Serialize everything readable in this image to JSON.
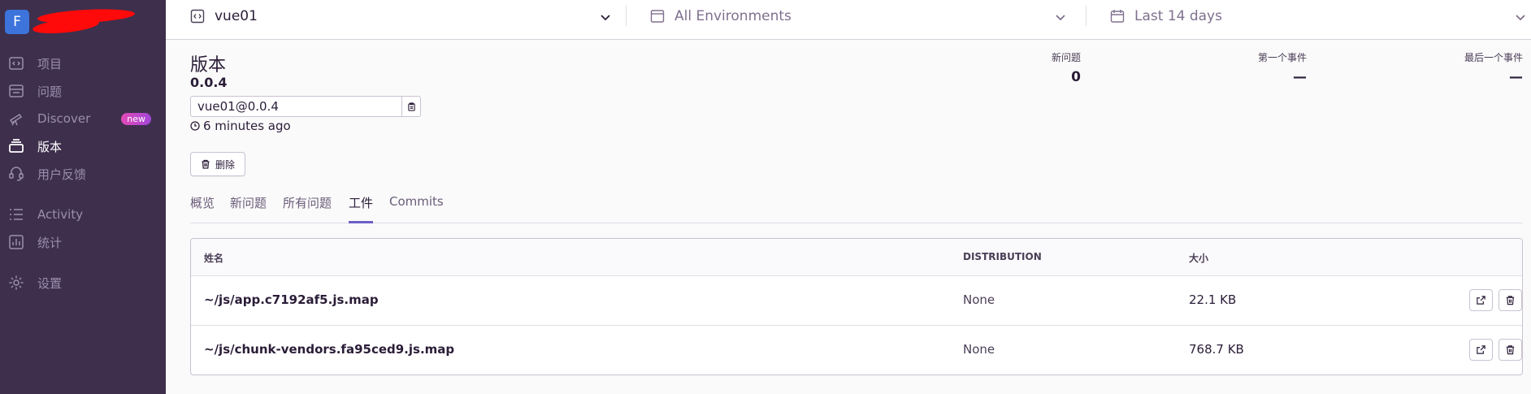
{
  "sidebar": {
    "org_initial": "F",
    "items": [
      {
        "label": "项目",
        "icon": "projects-icon"
      },
      {
        "label": "问题",
        "icon": "issues-icon"
      },
      {
        "label": "Discover",
        "icon": "telescope-icon",
        "badge": "new"
      },
      {
        "label": "版本",
        "icon": "releases-icon",
        "active": true
      },
      {
        "label": "用户反馈",
        "icon": "support-icon"
      },
      {
        "label": "Activity",
        "icon": "activity-icon"
      },
      {
        "label": "统计",
        "icon": "stats-icon"
      },
      {
        "label": "设置",
        "icon": "gear-icon"
      }
    ]
  },
  "header": {
    "project": "vue01",
    "environment": "All Environments",
    "period": "Last 14 days"
  },
  "release": {
    "title": "版本",
    "version": "0.0.4",
    "full_version": "vue01@0.0.4",
    "time_ago": "6 minutes ago",
    "delete_label": "删除"
  },
  "stats": {
    "new_issues_label": "新问题",
    "new_issues_value": "0",
    "first_event_label": "第一个事件",
    "first_event_value": "—",
    "last_event_label": "最后一个事件",
    "last_event_value": "—"
  },
  "tabs": [
    {
      "label": "概览"
    },
    {
      "label": "新问题"
    },
    {
      "label": "所有问题"
    },
    {
      "label": "工件",
      "active": true
    },
    {
      "label": "Commits"
    }
  ],
  "table": {
    "headers": {
      "name": "姓名",
      "distribution": "DISTRIBUTION",
      "size": "大小"
    },
    "rows": [
      {
        "name": "~/js/app.c7192af5.js.map",
        "distribution": "None",
        "size": "22.1 KB"
      },
      {
        "name": "~/js/chunk-vendors.fa95ced9.js.map",
        "distribution": "None",
        "size": "768.7 KB"
      }
    ]
  },
  "colors": {
    "sidebar_bg": "#3e2f4d",
    "accent": "#6c5fc7",
    "org_avatar": "#3d74db"
  }
}
